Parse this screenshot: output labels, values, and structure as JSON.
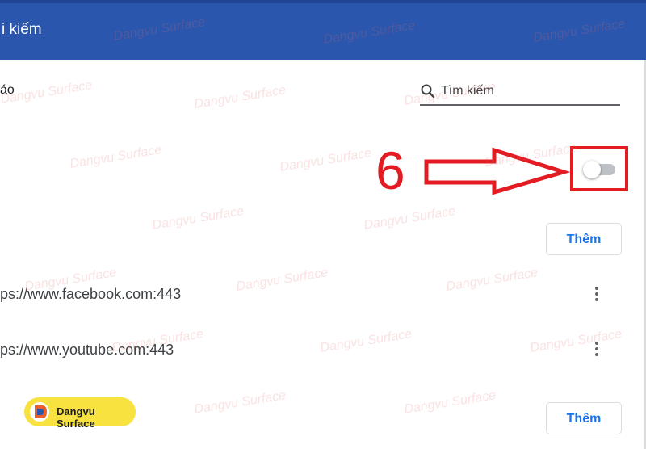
{
  "header": {
    "title": "i kiếm"
  },
  "section": {
    "title": "áo"
  },
  "search": {
    "placeholder": "Tìm kiếm"
  },
  "annotation": {
    "number": "6"
  },
  "toggle": {
    "state": "off"
  },
  "add_button_label": "Thêm",
  "sites": [
    {
      "url": "ps://www.facebook.com:443"
    },
    {
      "url": "ps://www.youtube.com:443"
    }
  ],
  "watermark": {
    "text": "Dangvu Surface"
  },
  "brand": {
    "name": "Dangvu Surface"
  },
  "colors": {
    "header_bg": "#2a56ad",
    "annotation_red": "#e31b23",
    "accent_blue": "#1a73e8",
    "badge_yellow": "#f7e23f"
  }
}
